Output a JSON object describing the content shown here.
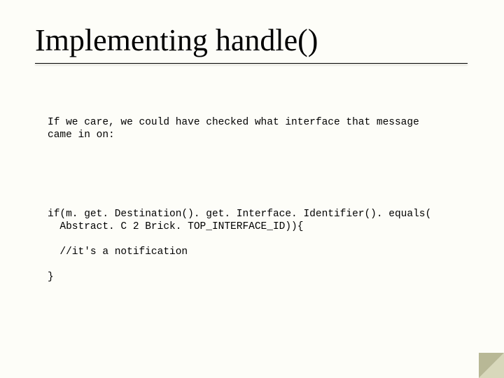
{
  "title": "Implementing handle()",
  "intro": "If we care, we could have checked what interface that message\ncame in on:",
  "code": "if(m. get. Destination(). get. Interface. Identifier(). equals(\n  Abstract. C 2 Brick. TOP_INTERFACE_ID)){\n\n  //it's a notification\n\n}"
}
